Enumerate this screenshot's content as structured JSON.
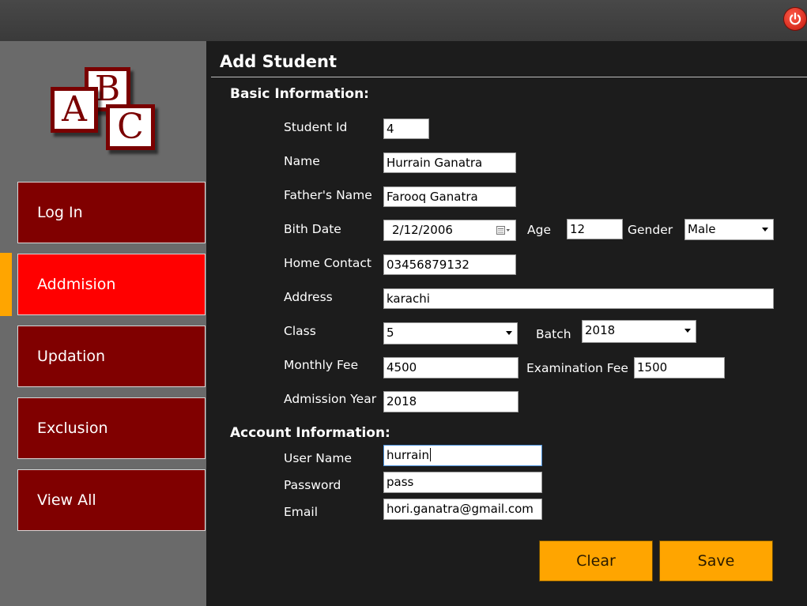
{
  "window": {
    "power_icon": "power-icon"
  },
  "logo": {
    "letters": [
      "A",
      "B",
      "C"
    ]
  },
  "sidebar": {
    "items": [
      {
        "label": "Log In"
      },
      {
        "label": "Addmision"
      },
      {
        "label": "Updation"
      },
      {
        "label": "Exclusion"
      },
      {
        "label": "View All"
      }
    ],
    "active_index": 1
  },
  "main": {
    "title": "Add Student",
    "basic_section": "Basic Information:",
    "account_section": "Account Information:"
  },
  "form": {
    "student_id": {
      "label": "Student Id",
      "value": "4"
    },
    "name": {
      "label": "Name",
      "value": "Hurrain Ganatra"
    },
    "father_name": {
      "label": "Father's Name",
      "value": "Farooq Ganatra"
    },
    "birth_date": {
      "label": "Bith Date",
      "value": "2/12/2006"
    },
    "age": {
      "label": "Age",
      "value": "12"
    },
    "gender": {
      "label": "Gender",
      "value": "Male"
    },
    "home_contact": {
      "label": "Home Contact",
      "value": "03456879132"
    },
    "address": {
      "label": "Address",
      "value": "karachi"
    },
    "class": {
      "label": "Class",
      "value": "5"
    },
    "batch": {
      "label": "Batch",
      "value": "2018"
    },
    "monthly_fee": {
      "label": "Monthly Fee",
      "value": "4500"
    },
    "examination_fee": {
      "label": "Examination Fee",
      "value": "1500"
    },
    "admission_year": {
      "label": "Admission Year",
      "value": "2018"
    },
    "user_name": {
      "label": "User Name",
      "value": "hurrain"
    },
    "password": {
      "label": "Password",
      "value": "pass"
    },
    "email": {
      "label": "Email",
      "value": "hori.ganatra@gmail.com"
    }
  },
  "actions": {
    "clear_label": "Clear",
    "save_label": "Save"
  },
  "colors": {
    "accent": "#ffa500",
    "nav": "#800000",
    "nav_active": "#ff0000",
    "sidebar": "#6a6a6a",
    "panel": "#1c1c1c"
  }
}
